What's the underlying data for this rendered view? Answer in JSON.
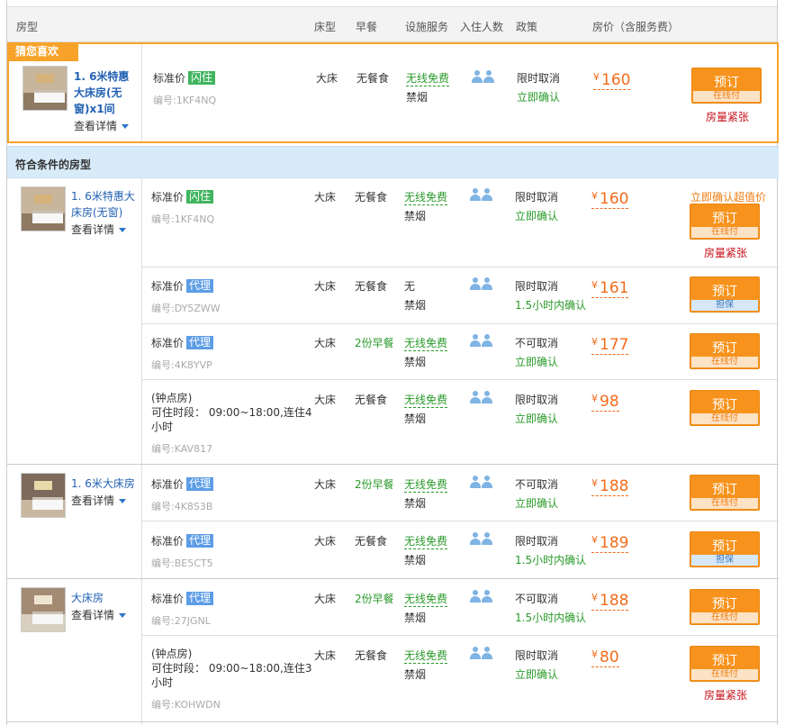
{
  "header": {
    "room_type": "房型",
    "bed_type": "床型",
    "breakfast": "早餐",
    "facilities": "设施服务",
    "occupancy": "入住人数",
    "policy": "政策",
    "price": "房价（含服务费）"
  },
  "favorite": {
    "tag": "猜您喜欢",
    "room_name": "1. 6米特惠大床房(无窗)x1间",
    "detail": "查看详情",
    "rate_label": "标准价",
    "badge": "闪住",
    "code": "编号:1KF4NQ",
    "bed": "大床",
    "breakfast": "无餐食",
    "wifi": "无线免费",
    "smoke": "禁烟",
    "policy1": "限时取消",
    "policy2": "立即确认",
    "currency": "¥",
    "price": "160",
    "btn": "预订",
    "btn_sub": "在线付",
    "note": "房量紧张"
  },
  "section_title": "符合条件的房型",
  "rooms": [
    {
      "name": "1. 6米特惠大床房(无窗)",
      "detail": "查看详情",
      "rates": [
        {
          "label": "标准价",
          "badge": "闪住",
          "code": "编号:1KF4NQ",
          "bed": "大床",
          "breakfast": "无餐食",
          "wifi": "无线免费",
          "smoke": "禁烟",
          "policy1": "限时取消",
          "policy2": "立即确认",
          "currency": "¥",
          "price": "160",
          "btn": "预订",
          "btn_sub": "在线付",
          "promo": "立即确认超值价",
          "note": "房量紧张"
        },
        {
          "label": "标准价",
          "badge": "代理",
          "code": "编号:DY5ZWW",
          "bed": "大床",
          "breakfast": "无餐食",
          "wifi": "无",
          "smoke": "禁烟",
          "policy1": "限时取消",
          "policy2": "1.5小时内确认",
          "currency": "¥",
          "price": "161",
          "btn": "预订",
          "btn_sub": "担保"
        },
        {
          "label": "标准价",
          "badge": "代理",
          "code": "编号:4K8YVP",
          "bed": "大床",
          "breakfast": "2份早餐",
          "wifi": "无线免费",
          "smoke": "禁烟",
          "policy1": "不可取消",
          "policy2": "立即确认",
          "currency": "¥",
          "price": "177",
          "btn": "预订",
          "btn_sub": "在线付"
        },
        {
          "label1": "(钟点房)",
          "label2": "可住时段： 09:00~18:00,连住4",
          "label3": "小时",
          "code": "编号:KAV817",
          "bed": "大床",
          "breakfast": "无餐食",
          "wifi": "无线免费",
          "smoke": "禁烟",
          "policy1": "限时取消",
          "policy2": "立即确认",
          "currency": "¥",
          "price": "98",
          "btn": "预订",
          "btn_sub": "在线付"
        }
      ]
    },
    {
      "name": "1. 6米大床房",
      "detail": "查看详情",
      "rates": [
        {
          "label": "标准价",
          "badge": "代理",
          "code": "编号:4K8S3B",
          "bed": "大床",
          "breakfast": "2份早餐",
          "wifi": "无线免费",
          "smoke": "禁烟",
          "policy1": "不可取消",
          "policy2": "立即确认",
          "currency": "¥",
          "price": "188",
          "btn": "预订",
          "btn_sub": "在线付"
        },
        {
          "label": "标准价",
          "badge": "代理",
          "code": "编号:BE5CT5",
          "bed": "大床",
          "breakfast": "无餐食",
          "wifi": "无线免费",
          "smoke": "禁烟",
          "policy1": "限时取消",
          "policy2": "1.5小时内确认",
          "currency": "¥",
          "price": "189",
          "btn": "预订",
          "btn_sub": "担保"
        }
      ]
    },
    {
      "name": "大床房",
      "detail": "查看详情",
      "rates": [
        {
          "label": "标准价",
          "badge": "代理",
          "code": "编号:27JGNL",
          "bed": "大床",
          "breakfast": "2份早餐",
          "wifi": "无线免费",
          "smoke": "禁烟",
          "policy1": "不可取消",
          "policy2": "1.5小时内确认",
          "currency": "¥",
          "price": "188",
          "btn": "预订",
          "btn_sub": "在线付"
        },
        {
          "label1": "(钟点房)",
          "label2": "可住时段： 09:00~18:00,连住3",
          "label3": "小时",
          "code": "编号:KOHWDN",
          "bed": "大床",
          "breakfast": "无餐食",
          "wifi": "无线免费",
          "smoke": "禁烟",
          "policy1": "限时取消",
          "policy2": "立即确认",
          "currency": "¥",
          "price": "80",
          "btn": "预订",
          "btn_sub": "在线付",
          "note": "房量紧张"
        }
      ]
    }
  ]
}
